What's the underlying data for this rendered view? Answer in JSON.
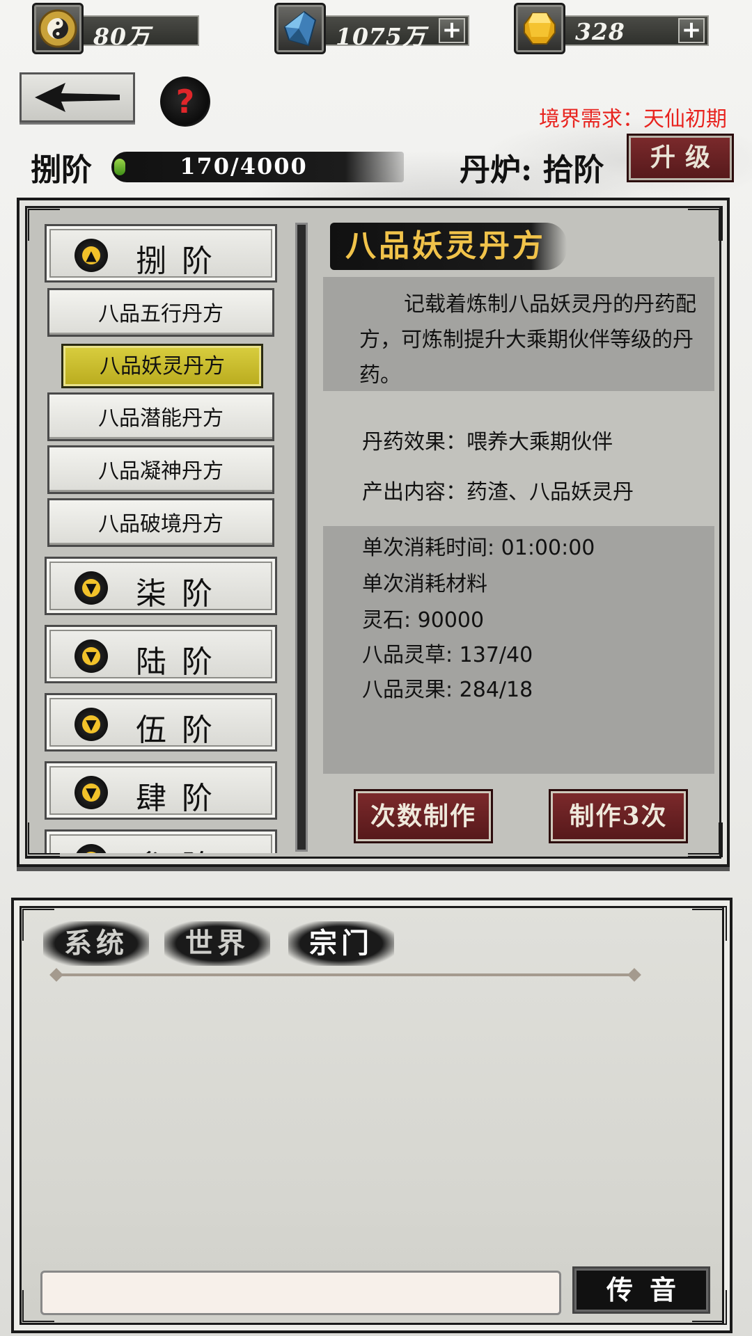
{
  "currencies": [
    {
      "name": "taiji-coin-icon",
      "value": "80万",
      "has_plus": false
    },
    {
      "name": "blue-crystal-icon",
      "value": "1075万",
      "has_plus": true
    },
    {
      "name": "gold-gem-icon",
      "value": "328",
      "has_plus": true
    }
  ],
  "header": {
    "help_symbol": "?",
    "realm_requirement": "境界需求：天仙初期",
    "current_tier": "捌阶",
    "progress_text": "170/4000",
    "progress_value": 170,
    "progress_max": 4000,
    "furnace_label": "丹炉: 拾阶",
    "upgrade_label": "升级"
  },
  "list": {
    "expanded_tier": "捌阶",
    "recipes": [
      "八品五行丹方",
      "八品妖灵丹方",
      "八品潜能丹方",
      "八品凝神丹方",
      "八品破境丹方"
    ],
    "selected_recipe": "八品妖灵丹方",
    "collapsed_tiers": [
      "柒阶",
      "陆阶",
      "伍阶",
      "肆阶",
      "叁阶"
    ]
  },
  "detail": {
    "title": "八品妖灵丹方",
    "description": "记载着炼制八品妖灵丹的丹药配方，可炼制提升大乘期伙伴等级的丹药。",
    "effect": "丹药效果：喂养大乘期伙伴",
    "output": "产出内容：药渣、八品妖灵丹",
    "time": "单次消耗时间: 01:00:00",
    "materials_title": "单次消耗材料",
    "materials": [
      "灵石: 90000",
      "八品灵草: 137/40",
      "八品灵果: 284/18"
    ],
    "btn_count_make": "次数制作",
    "btn_make_3": "制作3次"
  },
  "chat": {
    "tabs": [
      "系统",
      "世界",
      "宗门"
    ],
    "active_tab": "宗门",
    "input_value": "",
    "send_label": "传音"
  }
}
